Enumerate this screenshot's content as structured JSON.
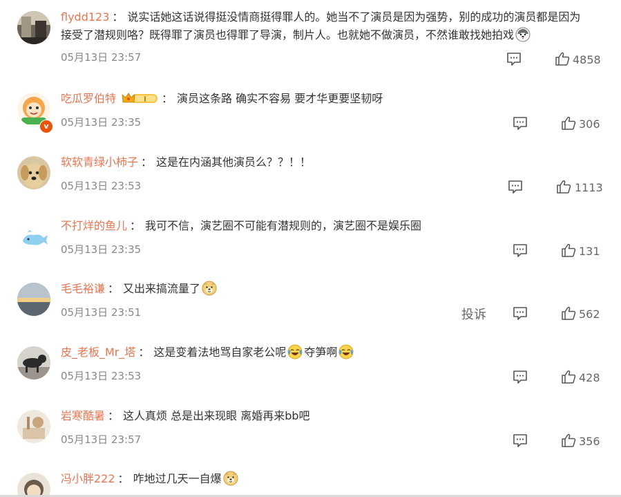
{
  "comments": [
    {
      "user": "flydd123",
      "text_line1": "说实话她这话说得挺没情商挺得罪人的。她当不了演员是因为强势，别的成功的演员都是因为",
      "text_line2": "接受了潜规则咯？既得罪了演员也得罪了导演，制片人。也就她不做演员，不然谁敢找她拍戏",
      "time": "05月13日 23:57",
      "likes": "4858"
    },
    {
      "user": "吃瓜罗伯特",
      "level": "I",
      "text_line1": "演员这条路 确实不容易 要才华更要坚韧呀",
      "time": "05月13日 23:35",
      "likes": "306"
    },
    {
      "user": "软软青绿小柿子",
      "text_line1": "这是在内涵其他演员么？？！！",
      "time": "05月13日 23:53",
      "likes": "1113"
    },
    {
      "user": "不打烊的鱼儿",
      "text_line1": "我可不信，演艺圈不可能有潜规则的，演艺圈不是娱乐圈",
      "time": "05月13日 23:35",
      "likes": "131"
    },
    {
      "user": "毛毛裕谦",
      "text_line1": "又出来搞流量了",
      "time": "05月13日 23:51",
      "report": "投诉",
      "likes": "562"
    },
    {
      "user": "皮_老板_Mr_塔",
      "text_line1a": "这是变着法地骂自家老公呢",
      "text_line1b": "夺笋啊",
      "time": "05月13日 23:53",
      "likes": "428"
    },
    {
      "user": "岩寒酷暑",
      "text_line1": "这人真烦 总是出来现眼 离婚再来bb吧",
      "time": "05月13日 23:57",
      "likes": "356"
    },
    {
      "user": "冯小胖222",
      "text_line1": "咋地过几天一自爆"
    }
  ],
  "icons": {
    "reply": "comment-icon",
    "like": "thumbs-up-icon",
    "emoji_dog": "doge-emoji-icon",
    "emoji_laugh_cry": "laugh-cry-emoji-icon",
    "emoji_husky": "husky-emoji-icon",
    "crown": "crown-badge-icon",
    "verified": "verified-badge-icon"
  },
  "colors": {
    "username": "#eb7350",
    "text": "#333333",
    "time": "#888888",
    "icon": "#666666"
  }
}
